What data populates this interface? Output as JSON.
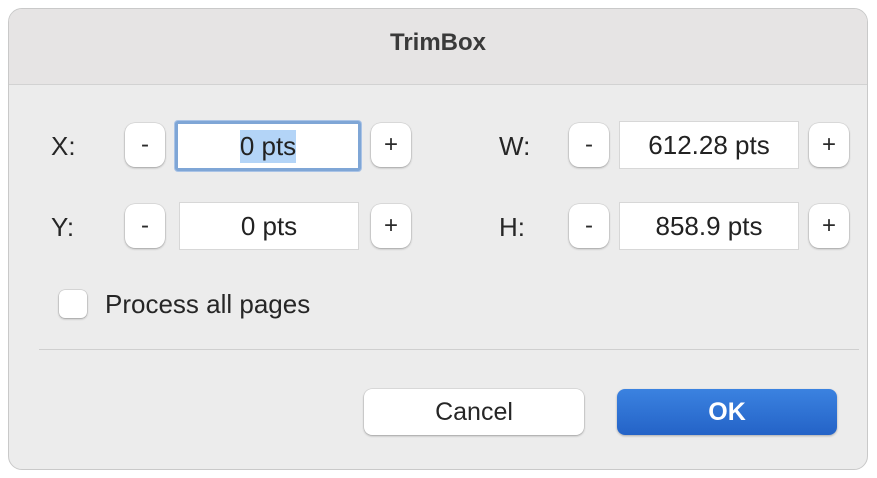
{
  "dialog": {
    "title": "TrimBox"
  },
  "fields": {
    "x": {
      "label": "X:",
      "value": "0 pts",
      "minus": "-",
      "plus": "+"
    },
    "y": {
      "label": "Y:",
      "value": "0 pts",
      "minus": "-",
      "plus": "+"
    },
    "w": {
      "label": "W:",
      "value": "612.28 pts",
      "minus": "-",
      "plus": "+"
    },
    "h": {
      "label": "H:",
      "value": "858.9 pts",
      "minus": "-",
      "plus": "+"
    }
  },
  "options": {
    "process_all_pages": {
      "label": "Process all pages",
      "checked": false
    }
  },
  "buttons": {
    "cancel": "Cancel",
    "ok": "OK"
  },
  "colors": {
    "accent": "#2463c7",
    "focus_ring": "#7fa6d6",
    "selection": "#b3d4f7"
  }
}
